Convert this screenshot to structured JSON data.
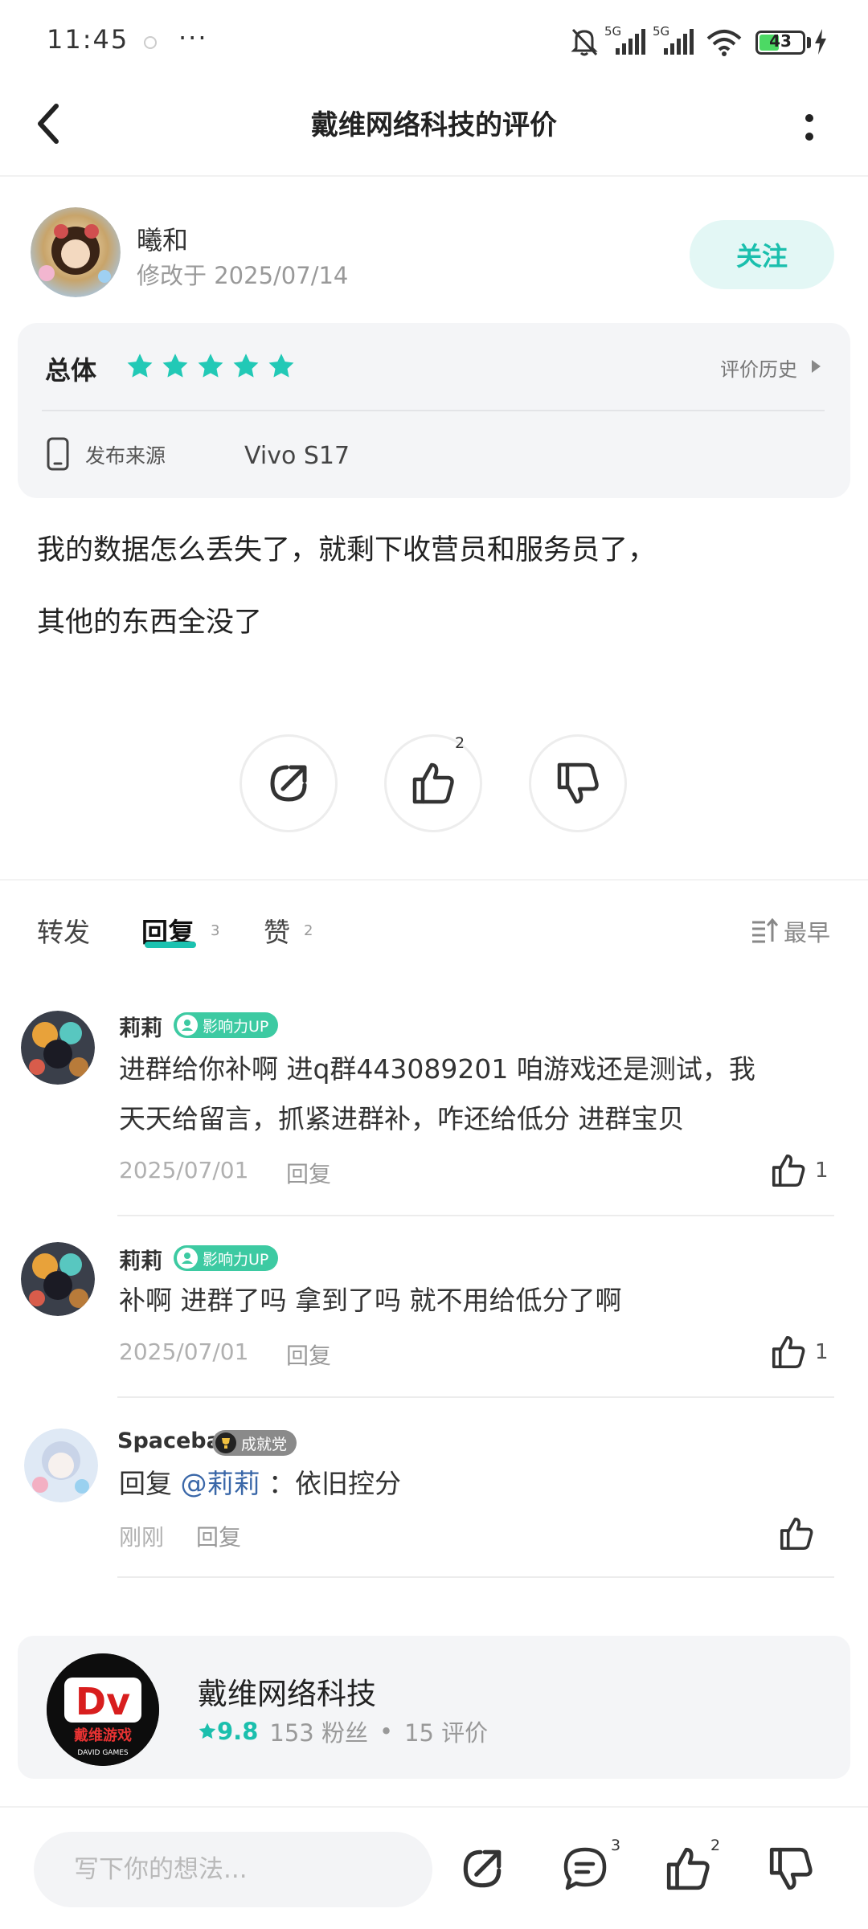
{
  "status_bar": {
    "time": "11:45",
    "dots": "···",
    "network1": "5G",
    "network2": "5G",
    "battery": "43"
  },
  "header": {
    "title": "戴维网络科技的评价"
  },
  "author": {
    "name": "曦和",
    "modified": "修改于 2025/07/14",
    "follow_label": "关注"
  },
  "rating": {
    "overall_label": "总体",
    "stars": 5,
    "history_label": "评价历史",
    "source_label": "发布来源",
    "source_value": "Vivo S17"
  },
  "review": {
    "line1": "我的数据怎么丢失了，就剩下收营员和服务员了，",
    "line2": "其他的东西全没了"
  },
  "actions": {
    "like_count": "2"
  },
  "tabs": {
    "forward": "转发",
    "reply": "回复",
    "reply_count": "3",
    "like": "赞",
    "like_count": "2",
    "sort": "最早"
  },
  "replies": [
    {
      "name": "莉莉",
      "badge": "影响力UP",
      "text1": "进群给你补啊 进q群443089201 咱游戏还是测试，我",
      "text2": "天天给留言，抓紧进群补，咋还给低分 进群宝贝",
      "date": "2025/07/01",
      "reply_label": "回复",
      "likes": "1"
    },
    {
      "name": "莉莉",
      "badge": "影响力UP",
      "text1": "补啊 进群了吗 拿到了吗 就不用给低分了啊",
      "date": "2025/07/01",
      "reply_label": "回复",
      "likes": "1"
    },
    {
      "name": "Spacebar",
      "badge": "成就党",
      "prefix": "回复",
      "mention": "@莉莉",
      "text1": "：依旧控分",
      "date": "刚刚",
      "reply_label": "回复"
    }
  ],
  "developer": {
    "name": "戴维网络科技",
    "rating": "9.8",
    "followers": "153 粉丝",
    "separator": "•",
    "reviews": "15 评价",
    "logo_text": "Dv",
    "logo_sub": "戴维游戏",
    "logo_caption": "DAVID GAMES"
  },
  "bottom_bar": {
    "placeholder": "写下你的想法...",
    "comment_count": "3",
    "like_count": "2"
  },
  "colors": {
    "accent": "#1bbfad",
    "star": "#22c9b6",
    "badge": "#3dcaa2",
    "mention": "#3a67a8"
  }
}
